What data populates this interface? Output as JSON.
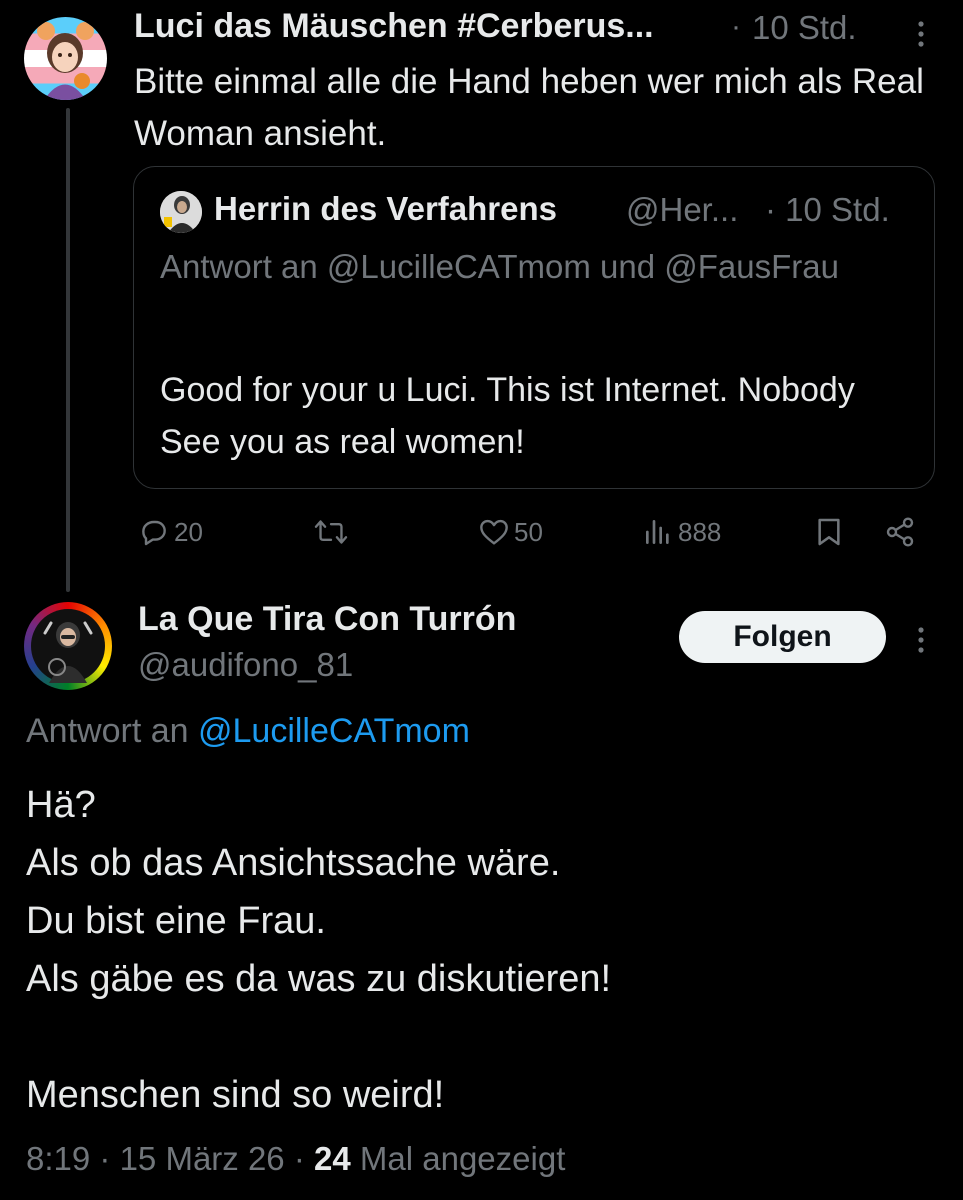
{
  "tweet1": {
    "name": "Luci das Mäuschen #Cerberus...",
    "separator": "·",
    "time": "10 Std.",
    "text": "Bitte einmal alle die Hand heben wer mich als Real Woman ansieht.",
    "quote": {
      "name": "Herrin des Verfahrens",
      "handle": "@Her...",
      "time": "· 10 Std.",
      "reply_to": "Antwort an @LucilleCATmom und @FausFrau",
      "text": "Good for your u Luci. This ist Internet. Nobody See you as real women!"
    },
    "actions": {
      "replies": "20",
      "retweets": "",
      "likes": "50",
      "views": "888"
    }
  },
  "tweet2": {
    "name": "La Que Tira Con Turrón",
    "handle": "@audifono_81",
    "follow_label": "Folgen",
    "reply_prefix": "Antwort an",
    "reply_mention": "@LucilleCATmom",
    "text": "Hä?\nAls ob das Ansichtssache wäre.\nDu bist eine Frau.\nAls gäbe es da was zu diskutieren!\n\nMenschen sind so weird!",
    "time": "8:19",
    "date": "15 März 26",
    "views_count": "24",
    "views_label": "Mal angezeigt"
  },
  "colors": {
    "background": "#000000",
    "text": "#e7e9ea",
    "secondary": "#71767b",
    "link": "#1d9bf0",
    "border": "#2f3336"
  }
}
